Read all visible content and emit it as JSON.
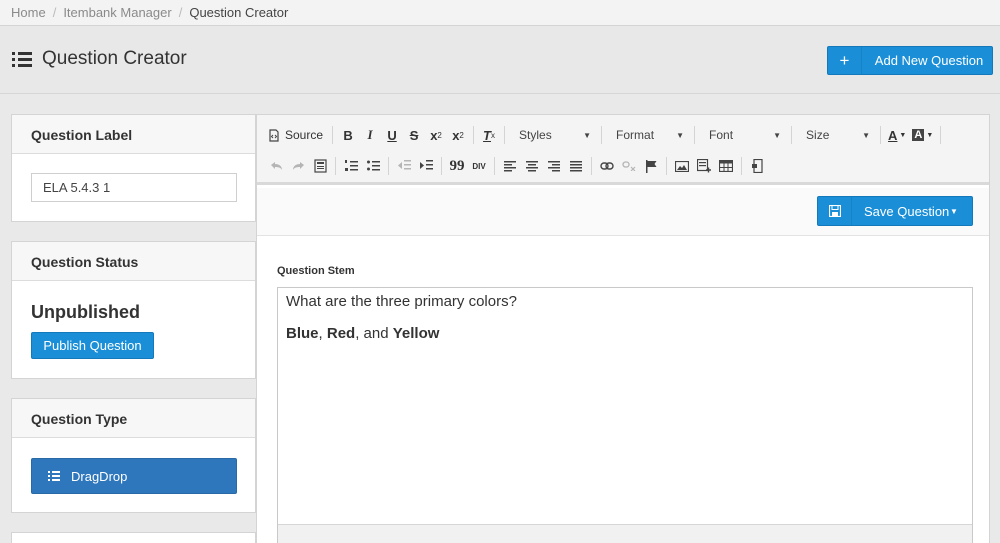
{
  "breadcrumb": {
    "items": [
      "Home",
      "Itembank Manager",
      "Question Creator"
    ],
    "separator": "/"
  },
  "header": {
    "title": "Question Creator",
    "title_icon": "list-icon",
    "add_button": {
      "icon": "plus-icon",
      "label": "Add New Question"
    }
  },
  "panels": {
    "label": {
      "heading": "Question Label",
      "value": "ELA 5.4.3 1"
    },
    "status": {
      "heading": "Question Status",
      "status": "Unpublished",
      "publish_label": "Publish Question"
    },
    "type": {
      "heading": "Question Type",
      "type_icon": "list-icon",
      "type_label": "DragDrop"
    }
  },
  "editor": {
    "toolbar": {
      "source_label": "Source",
      "bold": "B",
      "italic": "I",
      "underline": "U",
      "strike": "S",
      "subscript_base": "x",
      "subscript_mark": "2",
      "superscript_base": "x",
      "superscript_mark": "2",
      "remove_format": "T",
      "remove_format_mark": "x",
      "styles_label": "Styles",
      "format_label": "Format",
      "font_label": "Font",
      "size_label": "Size",
      "text_color_label": "A",
      "bg_color_label": "A",
      "blockquote_label": "99",
      "div_label": "DIV"
    },
    "save_label": "Save Question",
    "stem_label": "Question Stem",
    "stem_question": "What are the three primary colors?",
    "stem_answer": {
      "word1": "Blue",
      "sep1": ", ",
      "word2": "Red",
      "sep2": ", and ",
      "word3": "Yellow"
    }
  },
  "colors": {
    "primary": "#1a8fd8",
    "type_button": "#2f77bd",
    "background": "#e9e9e9"
  }
}
